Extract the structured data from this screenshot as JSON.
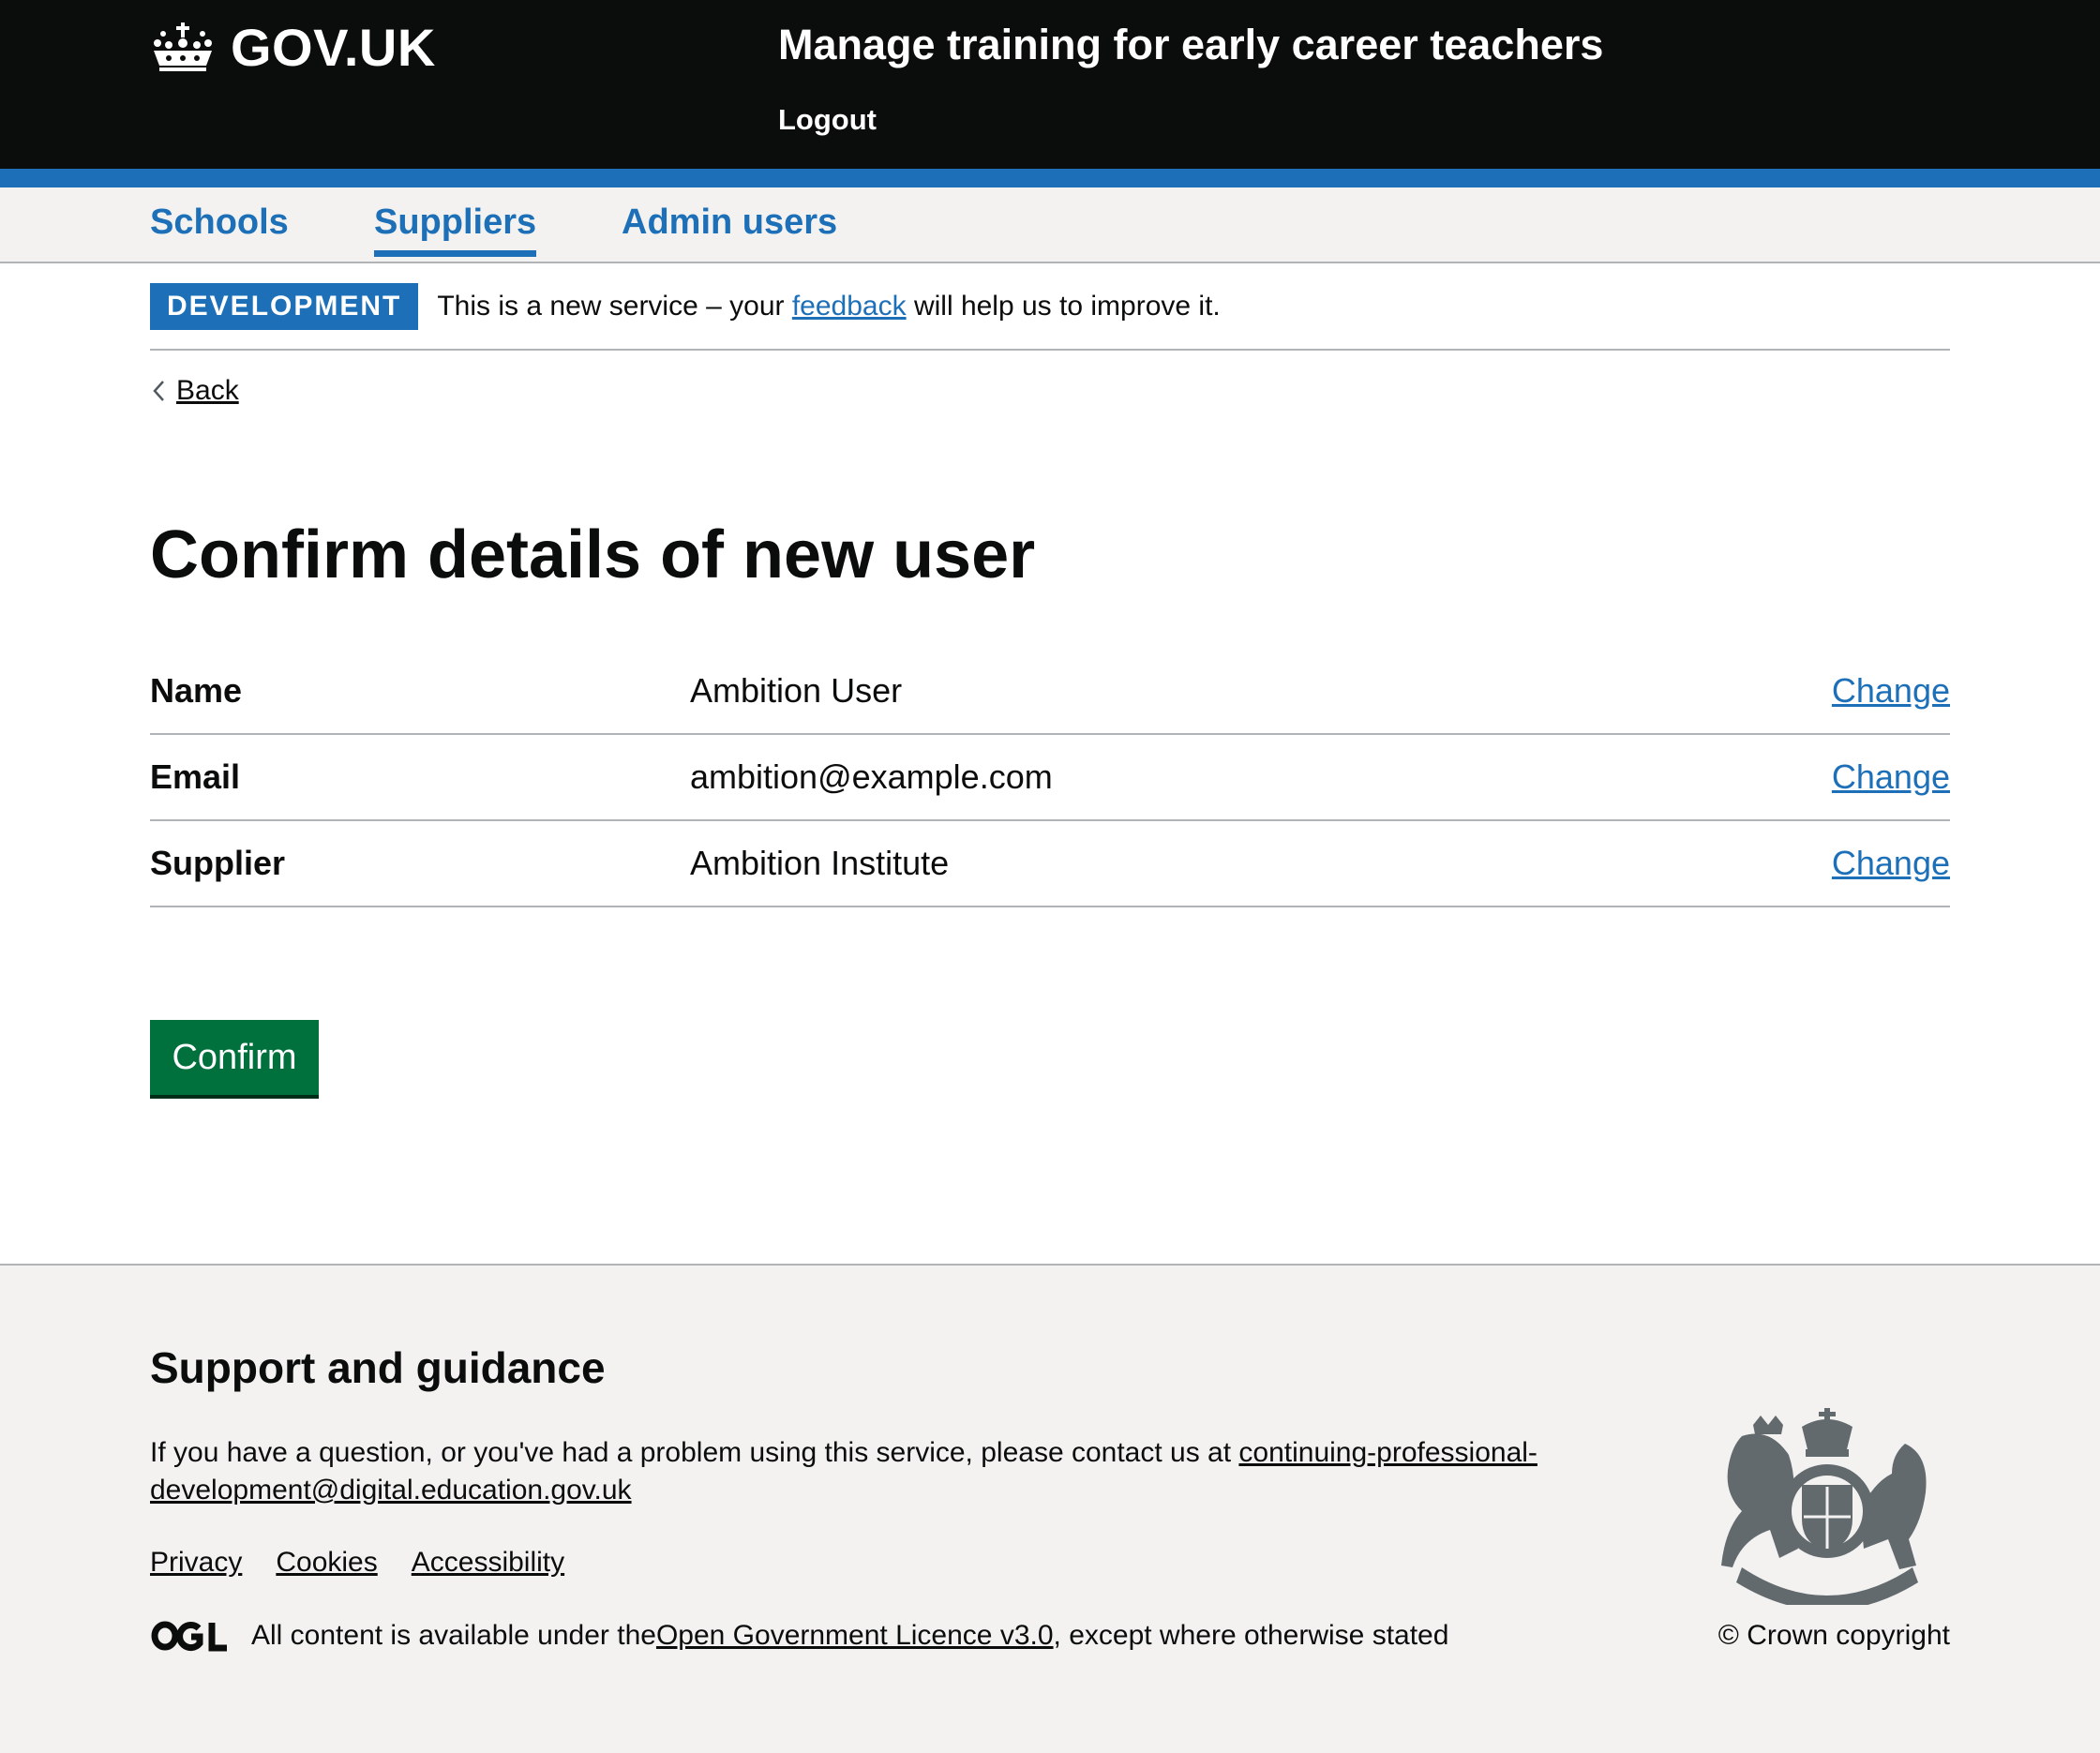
{
  "header": {
    "logo_text": "GOV.UK",
    "service_name": "Manage training for early career teachers",
    "logout_label": "Logout"
  },
  "nav": {
    "items": [
      {
        "label": "Schools",
        "active": false
      },
      {
        "label": "Suppliers",
        "active": true
      },
      {
        "label": "Admin users",
        "active": false
      }
    ]
  },
  "phase_banner": {
    "tag": "DEVELOPMENT",
    "text_before": "This is a new service – your ",
    "link_text": "feedback",
    "text_after": " will help us to improve it."
  },
  "back_link": "Back",
  "page_title": "Confirm details of new user",
  "summary": {
    "rows": [
      {
        "key": "Name",
        "value": "Ambition User",
        "action": "Change"
      },
      {
        "key": "Email",
        "value": "ambition@example.com",
        "action": "Change"
      },
      {
        "key": "Supplier",
        "value": "Ambition Institute",
        "action": "Change"
      }
    ]
  },
  "confirm_button": "Confirm",
  "footer": {
    "heading": "Support and guidance",
    "support_text": "If you have a question, or you've had a problem using this service, please contact us at ",
    "support_email": "continuing-professional-development@digital.education.gov.uk",
    "links": [
      "Privacy",
      "Cookies",
      "Accessibility"
    ],
    "licence_before": "All content is available under the ",
    "licence_link": "Open Government Licence v3.0",
    "licence_after": ", except where otherwise stated",
    "copyright": "© Crown copyright"
  },
  "colors": {
    "header_bg": "#0b0c0c",
    "brand_blue": "#1d70b8",
    "button_green": "#00703c",
    "footer_bg": "#f3f2f1"
  },
  "icons": [
    "crown-icon",
    "back-chevron-icon",
    "ogl-logo-icon",
    "royal-coat-of-arms-icon"
  ]
}
